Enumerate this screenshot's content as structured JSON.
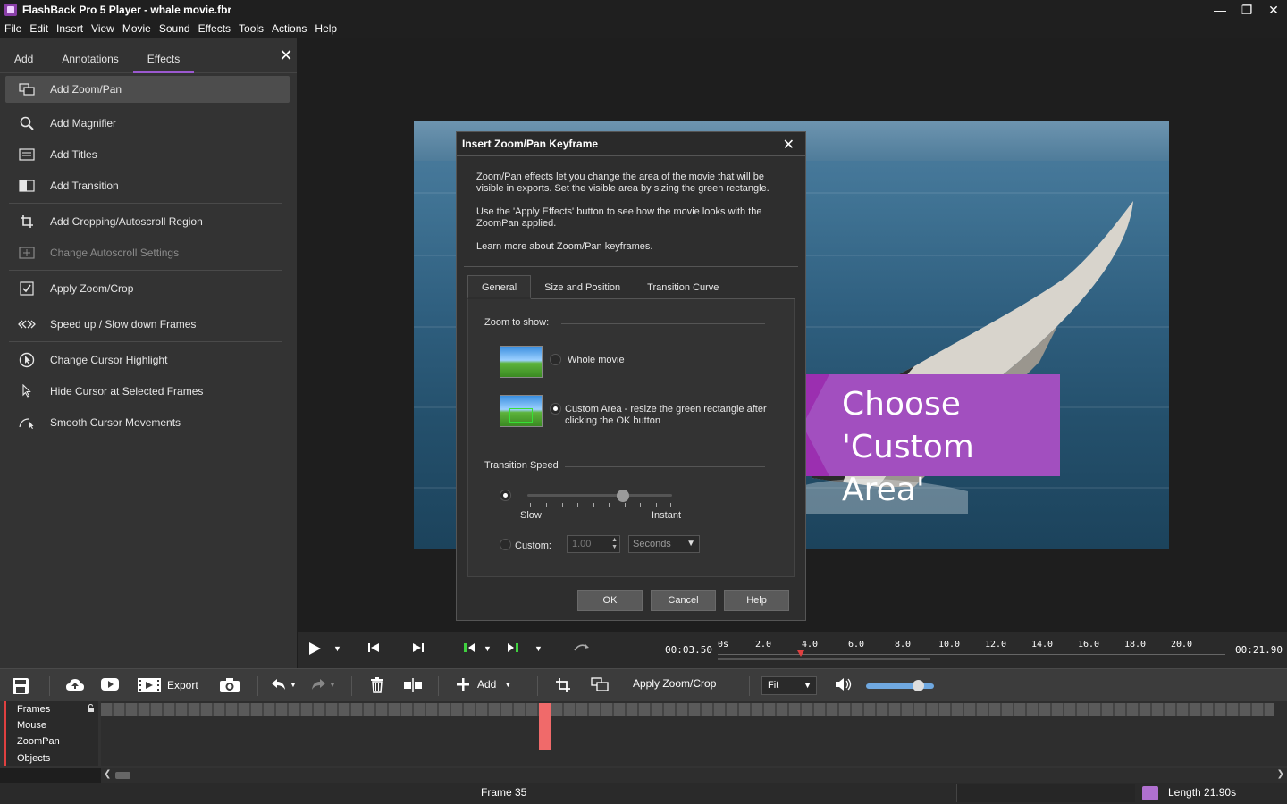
{
  "window": {
    "title": "FlashBack Pro 5 Player - whale movie.fbr",
    "controls": [
      "minimize-icon",
      "restore-icon",
      "close-icon"
    ]
  },
  "menu": [
    "File",
    "Edit",
    "Insert",
    "View",
    "Movie",
    "Sound",
    "Effects",
    "Tools",
    "Actions",
    "Help"
  ],
  "left_panel": {
    "tabs": [
      "Add",
      "Annotations",
      "Effects"
    ],
    "active_tab": "Effects",
    "items": [
      {
        "label": "Add Zoom/Pan",
        "icon": "zoom-pan-icon"
      },
      {
        "label": "Add Magnifier",
        "icon": "magnifier-icon"
      },
      {
        "label": "Add Titles",
        "icon": "titles-icon"
      },
      {
        "label": "Add Transition",
        "icon": "transition-icon"
      },
      {
        "label": "Add Cropping/Autoscroll Region",
        "icon": "crop-icon"
      },
      {
        "label": "Change Autoscroll Settings",
        "icon": "autoscroll-icon"
      },
      {
        "label": "Apply Zoom/Crop",
        "icon": "checkbox-icon"
      },
      {
        "label": "Speed up / Slow down Frames",
        "icon": "speed-icon"
      },
      {
        "label": "Change Cursor Highlight",
        "icon": "cursor-highlight-icon"
      },
      {
        "label": "Hide Cursor at Selected Frames",
        "icon": "cursor-icon"
      },
      {
        "label": "Smooth Cursor Movements",
        "icon": "smooth-cursor-icon"
      }
    ]
  },
  "dialog": {
    "title": "Insert Zoom/Pan Keyframe",
    "desc1": "Zoom/Pan effects let you change the area of the movie that will be visible in exports. Set the visible area by sizing the green rectangle.",
    "desc2": "Use the 'Apply Effects' button to see how the movie looks with the ZoomPan applied.",
    "desc3": "Learn more about Zoom/Pan keyframes.",
    "tabs": [
      "General",
      "Size and Position",
      "Transition Curve"
    ],
    "zoom_label": "Zoom to show:",
    "opt_whole": "Whole movie",
    "opt_custom_1": "Custom Area - resize the green rectangle after",
    "opt_custom_2": "clicking the OK button",
    "speed_label": "Transition Speed",
    "slow": "Slow",
    "instant": "Instant",
    "custom_label": "Custom:",
    "custom_value": "1.00",
    "unit": "Seconds",
    "ok": "OK",
    "cancel": "Cancel",
    "help": "Help"
  },
  "callout": {
    "line1": "Choose",
    "line2": "'Custom Area'",
    "color": "#a24fbf"
  },
  "transport": {
    "current_time": "00:03.50",
    "length_time": "00:21.90",
    "ruler": [
      "0s",
      "2.0",
      "4.0",
      "6.0",
      "8.0",
      "10.0",
      "12.0",
      "14.0",
      "16.0",
      "18.0",
      "20.0"
    ]
  },
  "toolbar": {
    "export": "Export",
    "add": "Add",
    "apply_zoom": "Apply Zoom/Crop",
    "fit": "Fit"
  },
  "tracks": [
    "Frames",
    "Mouse",
    "ZoomPan",
    "Objects"
  ],
  "status": {
    "frame": "Frame 35",
    "length": "Length 21.90s"
  }
}
